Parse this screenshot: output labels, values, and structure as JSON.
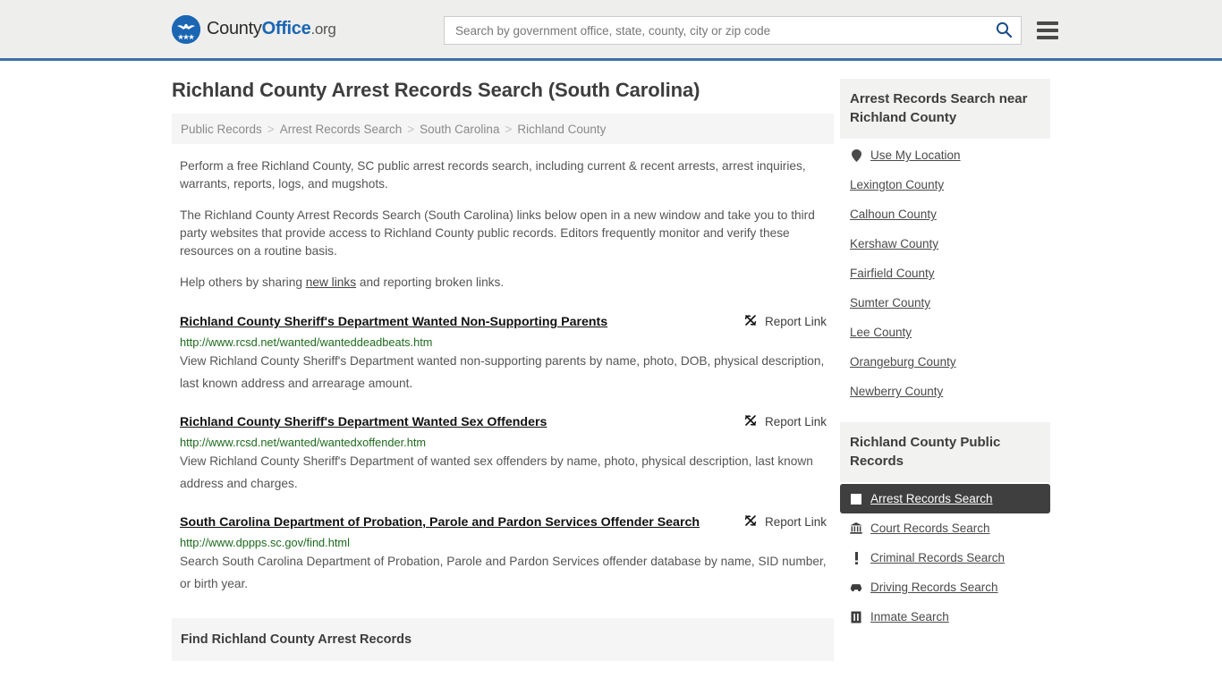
{
  "header": {
    "logo": {
      "icon": "eagle-seal-icon",
      "part1": "County",
      "part2": "Office",
      "part3": ".org"
    },
    "search": {
      "placeholder": "Search by government office, state, county, city or zip code",
      "value": "",
      "search_icon": "search-icon"
    },
    "menu_icon": "hamburger-menu-icon"
  },
  "page_title": "Richland County Arrest Records Search (South Carolina)",
  "breadcrumb": {
    "items": [
      {
        "label": "Public Records"
      },
      {
        "label": "Arrest Records Search"
      },
      {
        "label": "South Carolina"
      },
      {
        "label": "Richland County"
      }
    ],
    "separator": ">"
  },
  "intro": {
    "p1": "Perform a free Richland County, SC public arrest records search, including current & recent arrests, arrest inquiries, warrants, reports, logs, and mugshots.",
    "p2": "The Richland County Arrest Records Search (South Carolina) links below open in a new window and take you to third party websites that provide access to Richland County public records. Editors frequently monitor and verify these resources on a routine basis.",
    "p3_before": "Help others by sharing ",
    "p3_link": "new links",
    "p3_after": " and reporting broken links."
  },
  "report_link_label": "Report Link",
  "report_link_icon": "broken-link-icon",
  "results": [
    {
      "title": "Richland County Sheriff's Department Wanted Non-Supporting Parents",
      "url": "http://www.rcsd.net/wanted/wanteddeadbeats.htm",
      "description": "View Richland County Sheriff's Department wanted non-supporting parents by name, photo, DOB, physical description, last known address and arrearage amount."
    },
    {
      "title": "Richland County Sheriff's Department Wanted Sex Offenders",
      "url": "http://www.rcsd.net/wanted/wantedxoffender.htm",
      "description": "View Richland County Sheriff's Department of wanted sex offenders by name, photo, physical description, last known address and charges."
    },
    {
      "title": "South Carolina Department of Probation, Parole and Pardon Services Offender Search",
      "url": "http://www.dppps.sc.gov/find.html",
      "description": "Search South Carolina Department of Probation, Parole and Pardon Services offender database by name, SID number, or birth year."
    }
  ],
  "find_section_title": "Find Richland County Arrest Records",
  "sidebar": {
    "nearby": {
      "heading": "Arrest Records Search near Richland County",
      "items": [
        {
          "label": "Use My Location",
          "icon": "map-pin-icon"
        },
        {
          "label": "Lexington County",
          "icon": ""
        },
        {
          "label": "Calhoun County",
          "icon": ""
        },
        {
          "label": "Kershaw County",
          "icon": ""
        },
        {
          "label": "Fairfield County",
          "icon": ""
        },
        {
          "label": "Sumter County",
          "icon": ""
        },
        {
          "label": "Lee County",
          "icon": ""
        },
        {
          "label": "Orangeburg County",
          "icon": ""
        },
        {
          "label": "Newberry County",
          "icon": ""
        }
      ]
    },
    "public_records": {
      "heading": "Richland County Public Records",
      "items": [
        {
          "label": "Arrest Records Search",
          "icon": "handcuffs-icon",
          "active": true
        },
        {
          "label": "Court Records Search",
          "icon": "courthouse-icon",
          "active": false
        },
        {
          "label": "Criminal Records Search",
          "icon": "exclamation-icon",
          "active": false
        },
        {
          "label": "Driving Records Search",
          "icon": "car-icon",
          "active": false
        },
        {
          "label": "Inmate Search",
          "icon": "jail-icon",
          "active": false
        }
      ]
    }
  },
  "colors": {
    "header_bg": "#eeeeec",
    "header_border": "#3b72a8",
    "brand_blue": "#1a66b3",
    "url_green": "#1d6b1d",
    "active_bg": "#3f3f3f",
    "panel_bg": "#f2f2f0"
  }
}
